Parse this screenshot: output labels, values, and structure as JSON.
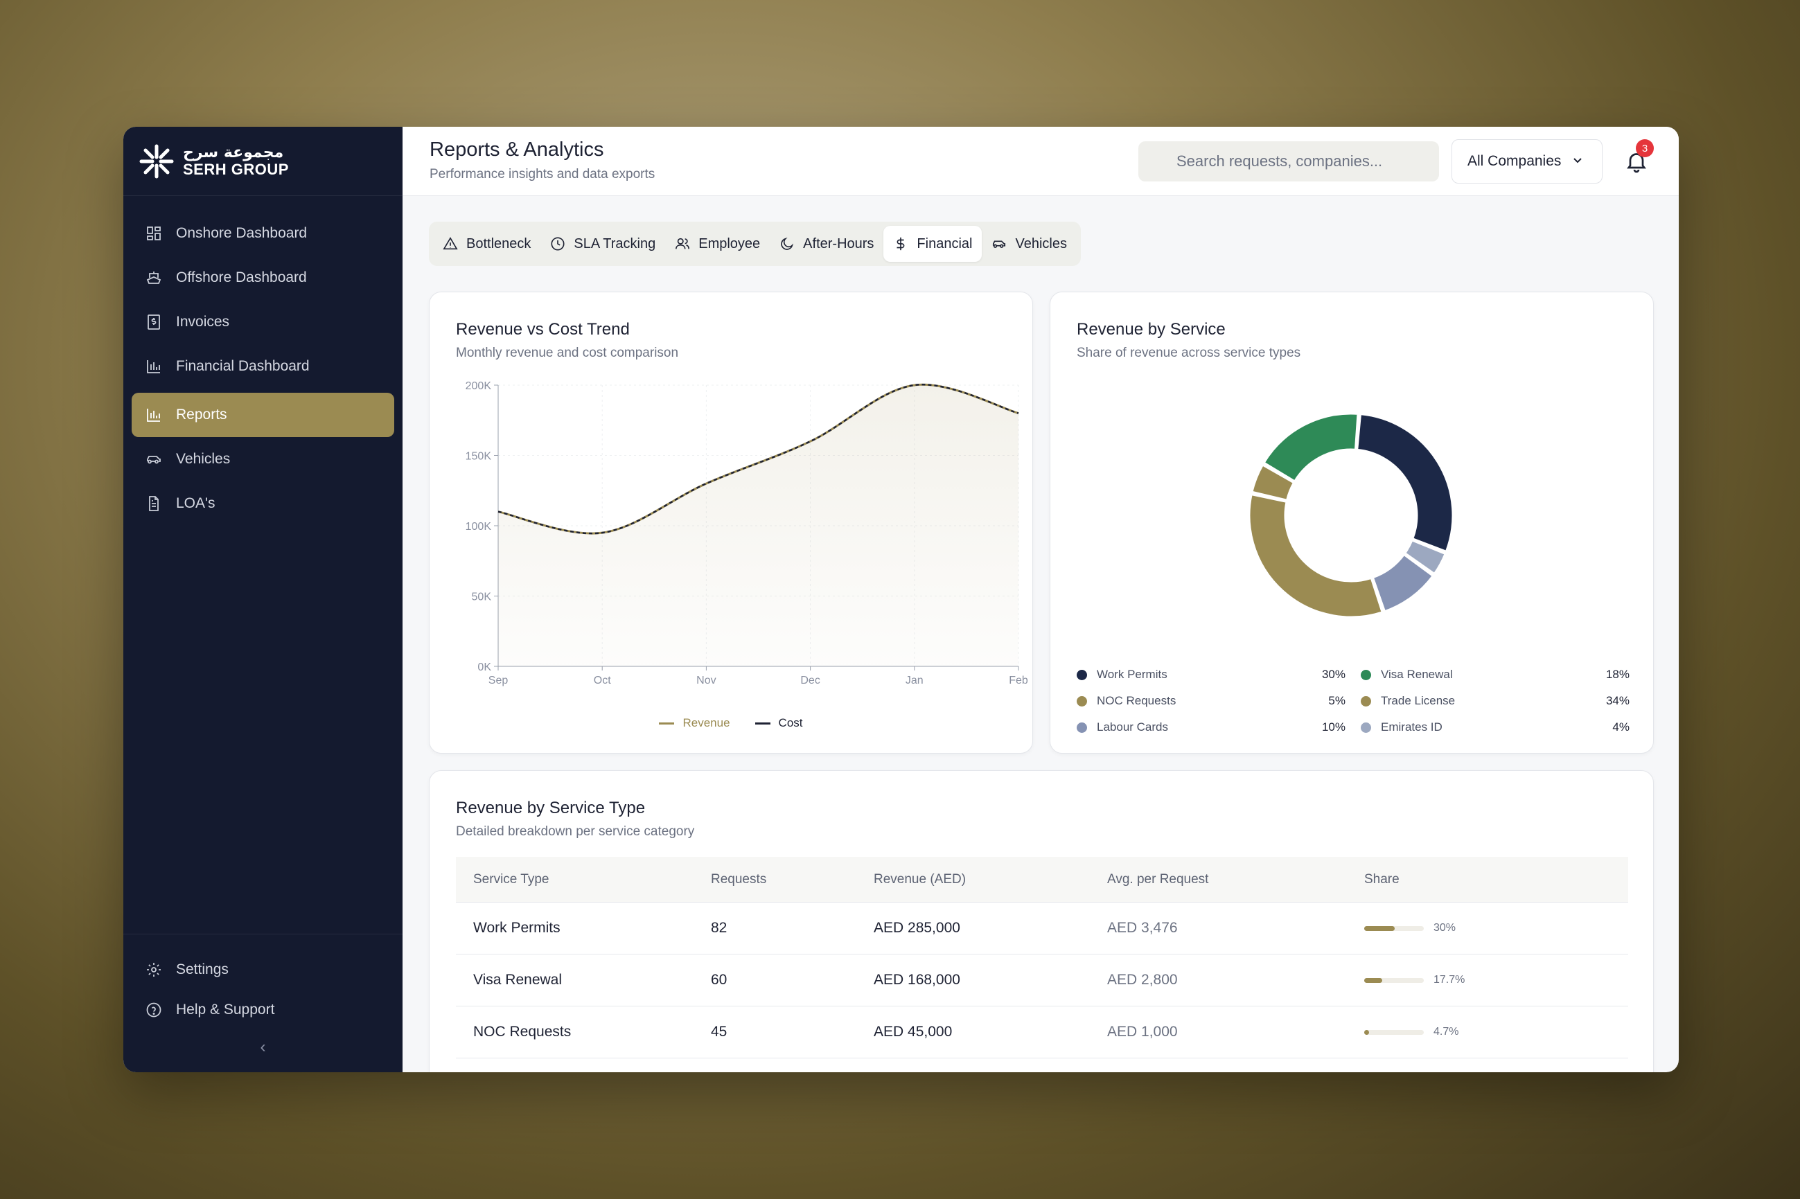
{
  "brand": {
    "arabic": "مجموعة سرح",
    "english": "SERH GROUP"
  },
  "sidebar": {
    "items": [
      {
        "label": "Onshore Dashboard",
        "icon": "grid-icon"
      },
      {
        "label": "Offshore Dashboard",
        "icon": "ship-icon"
      },
      {
        "label": "Invoices",
        "icon": "invoice-icon"
      },
      {
        "label": "Financial Dashboard",
        "icon": "bar-chart-icon"
      },
      {
        "label": "Reports",
        "icon": "bar-chart-icon",
        "active": true
      },
      {
        "label": "Vehicles",
        "icon": "car-icon"
      },
      {
        "label": "LOA's",
        "icon": "document-icon"
      }
    ],
    "bottom": [
      {
        "label": "Settings",
        "icon": "gear-icon"
      },
      {
        "label": "Help & Support",
        "icon": "help-icon"
      }
    ],
    "collapse_glyph": "‹"
  },
  "header": {
    "title": "Reports & Analytics",
    "subtitle": "Performance insights and data exports",
    "search_placeholder": "Search requests, companies...",
    "company_select": "All Companies",
    "notifications": "3"
  },
  "tabs": [
    {
      "label": "Bottleneck",
      "icon": "warning-icon"
    },
    {
      "label": "SLA Tracking",
      "icon": "clock-icon"
    },
    {
      "label": "Employee",
      "icon": "users-icon"
    },
    {
      "label": "After-Hours",
      "icon": "moon-icon"
    },
    {
      "label": "Financial",
      "icon": "dollar-icon",
      "active": true
    },
    {
      "label": "Vehicles",
      "icon": "car-icon"
    }
  ],
  "trend_card": {
    "title": "Revenue vs Cost Trend",
    "subtitle": "Monthly revenue and cost comparison"
  },
  "service_card": {
    "title": "Revenue by Service",
    "subtitle": "Share of revenue across service types"
  },
  "table_card": {
    "title": "Revenue by Service Type",
    "subtitle": "Detailed breakdown per service category",
    "columns": [
      "Service Type",
      "Requests",
      "Revenue (AED)",
      "Avg. per Request",
      "Share"
    ],
    "rows": [
      {
        "service": "Work Permits",
        "requests": "82",
        "revenue": "AED 285,000",
        "avg": "AED 3,476",
        "share": "30%",
        "share_value": 0.3
      },
      {
        "service": "Visa Renewal",
        "requests": "60",
        "revenue": "AED 168,000",
        "avg": "AED 2,800",
        "share": "17.7%",
        "share_value": 0.177
      },
      {
        "service": "NOC Requests",
        "requests": "45",
        "revenue": "AED 45,000",
        "avg": "AED 1,000",
        "share": "4.7%",
        "share_value": 0.047
      }
    ]
  },
  "chart_data": [
    {
      "type": "line",
      "title": "Revenue vs Cost Trend",
      "categories": [
        "Sep",
        "Oct",
        "Nov",
        "Dec",
        "Jan",
        "Feb"
      ],
      "ylim": [
        0,
        200000
      ],
      "yticks": [
        "0K",
        "50K",
        "100K",
        "150K",
        "200K"
      ],
      "ytick_values": [
        0,
        50000,
        100000,
        150000,
        200000
      ],
      "grid": true,
      "legend": "bottom",
      "series": [
        {
          "name": "Revenue",
          "color": "#9b8b52",
          "values": [
            110000,
            95000,
            130000,
            160000,
            200000,
            180000
          ],
          "area": true
        },
        {
          "name": "Cost",
          "color": "#1e2233",
          "values": [
            110000,
            95000,
            130000,
            160000,
            200000,
            180000
          ],
          "dashed": true
        }
      ]
    },
    {
      "type": "pie",
      "title": "Revenue by Service",
      "donut": true,
      "legend": "bottom",
      "slices": [
        {
          "name": "Work Permits",
          "label": "30%",
          "value": 30,
          "color": "#1c2847"
        },
        {
          "name": "Visa Renewal",
          "label": "18%",
          "value": 18,
          "color": "#2e8a57"
        },
        {
          "name": "NOC Requests",
          "label": "5%",
          "value": 5,
          "color": "#9b8b52"
        },
        {
          "name": "Trade License",
          "label": "34%",
          "value": 34,
          "color": "#9b8b52"
        },
        {
          "name": "Labour Cards",
          "label": "10%",
          "value": 10,
          "color": "#8592b3"
        },
        {
          "name": "Emirates ID",
          "label": "4%",
          "value": 4,
          "color": "#9ca8c0"
        }
      ],
      "draw_order": [
        "Work Permits",
        "Emirates ID",
        "Labour Cards",
        "Trade License",
        "NOC Requests",
        "Visa Renewal"
      ]
    }
  ]
}
